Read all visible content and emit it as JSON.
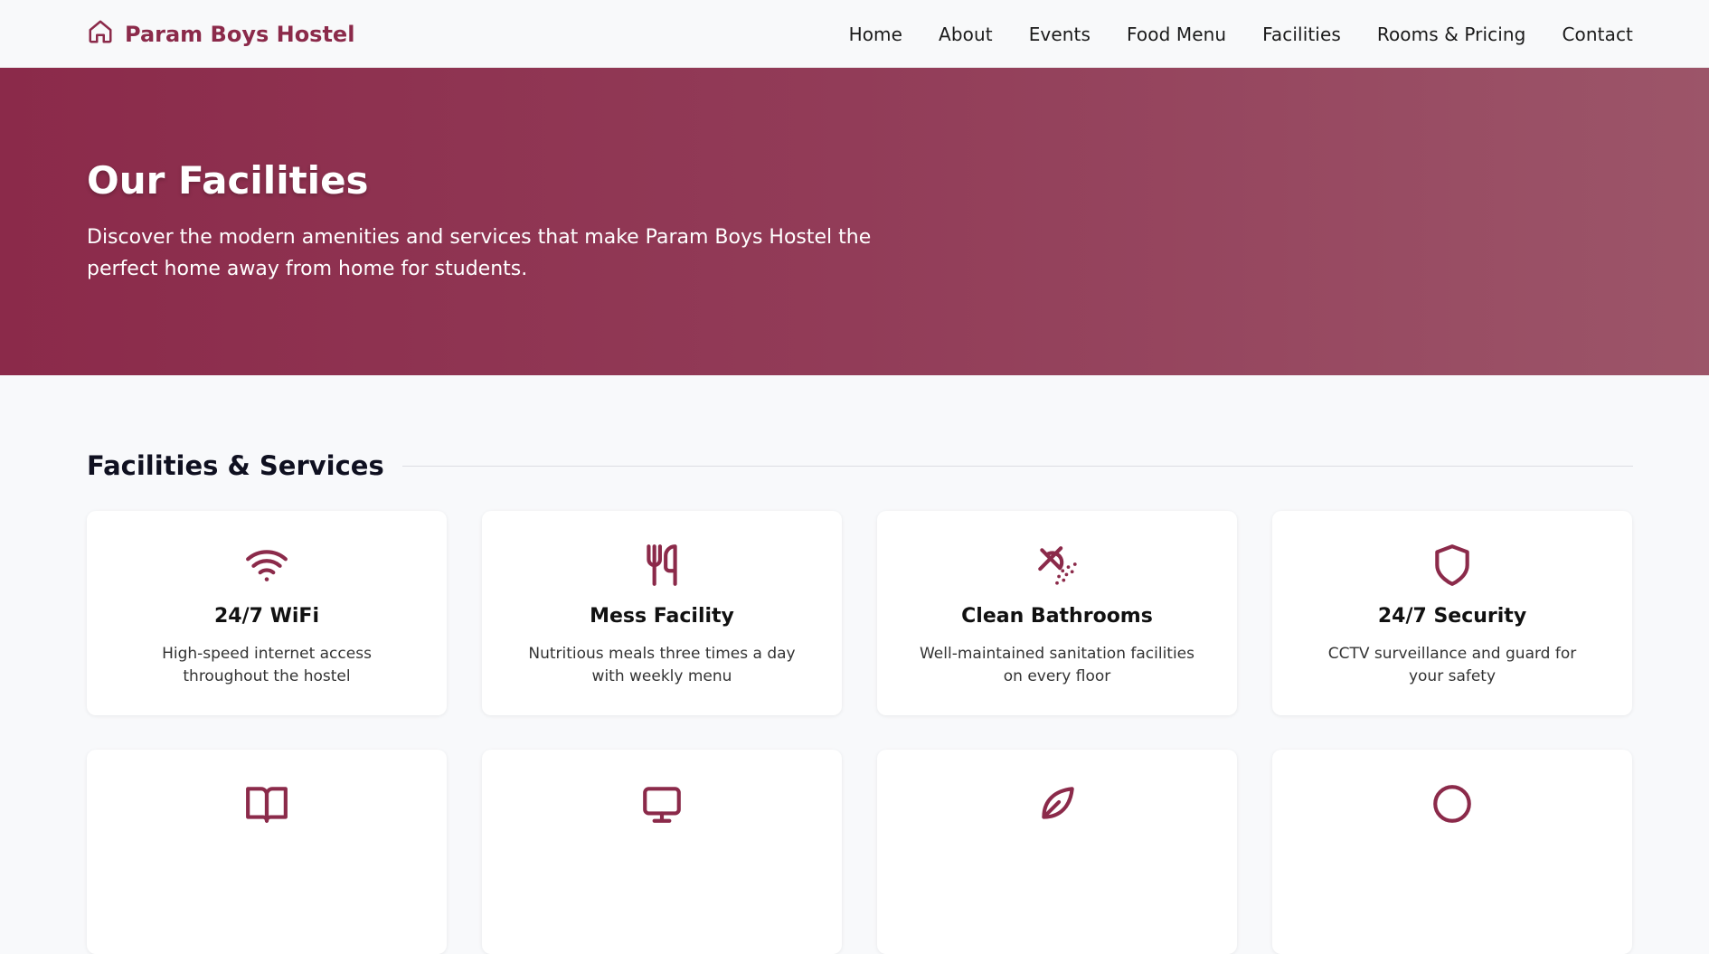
{
  "brand": {
    "name": "Param Boys Hostel",
    "icon": "home-icon"
  },
  "nav": {
    "items": [
      {
        "label": "Home"
      },
      {
        "label": "About"
      },
      {
        "label": "Events"
      },
      {
        "label": "Food Menu"
      },
      {
        "label": "Facilities"
      },
      {
        "label": "Rooms & Pricing"
      },
      {
        "label": "Contact"
      }
    ]
  },
  "hero": {
    "title": "Our Facilities",
    "subtitle": "Discover the modern amenities and services that make Param Boys Hostel the perfect home away from home for students."
  },
  "section": {
    "title": "Facilities & Services"
  },
  "facilities": [
    {
      "icon": "wifi-icon",
      "title": "24/7 WiFi",
      "desc": "High-speed internet access throughout the hostel"
    },
    {
      "icon": "utensils-icon",
      "title": "Mess Facility",
      "desc": "Nutritious meals three times a day with weekly menu"
    },
    {
      "icon": "shower-icon",
      "title": "Clean Bathrooms",
      "desc": "Well-maintained sanitation facilities on every floor"
    },
    {
      "icon": "shield-icon",
      "title": "24/7 Security",
      "desc": "CCTV surveillance and guard for your safety"
    }
  ],
  "colors": {
    "accent": "#8b2a4a",
    "hero_start": "#8b2a4a",
    "hero_end": "#9c5569",
    "background": "#f8f9fb"
  }
}
